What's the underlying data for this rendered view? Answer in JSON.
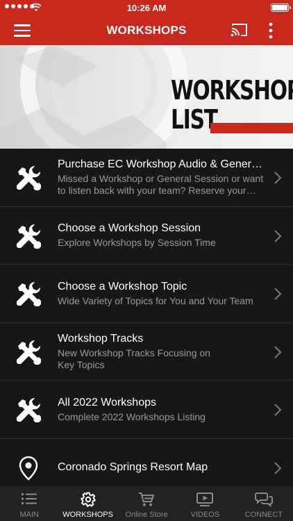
{
  "status_bar": {
    "time": "10:26 AM"
  },
  "nav": {
    "title": "WORKSHOPS"
  },
  "hero": {
    "title_line1": "WORKSHOP",
    "title_line2": "LIST"
  },
  "list": [
    {
      "title": "Purchase EC Workshop Audio & General Session",
      "subtitle": "Missed a Workshop or General Session or want to listen back with your team? Reserve your copy today",
      "icon": "tools-icon"
    },
    {
      "title": "Choose a Workshop Session",
      "subtitle": "Explore Workshops by Session Time",
      "icon": "tools-icon"
    },
    {
      "title": "Choose a Workshop Topic",
      "subtitle": "Wide Variety of Topics for You and Your Team",
      "icon": "tools-icon"
    },
    {
      "title": "Workshop Tracks",
      "subtitle": "New Workshop Tracks Focusing on Key Topics",
      "icon": "tools-icon"
    },
    {
      "title": "All 2022 Workshops",
      "subtitle": "Complete 2022 Workshops Listing",
      "icon": "tools-icon"
    },
    {
      "title": "Coronado Springs Resort Map",
      "subtitle": "",
      "icon": "map-pin-icon"
    }
  ],
  "tabs": [
    {
      "label": "MAIN",
      "icon": "list-icon"
    },
    {
      "label": "WORKSHOPS",
      "icon": "gear-icon"
    },
    {
      "label": "Online Store",
      "icon": "cart-icon"
    },
    {
      "label": "VIDEOS",
      "icon": "video-icon"
    },
    {
      "label": "CONNECT",
      "icon": "chat-icon"
    }
  ],
  "colors": {
    "brand_red": "#c8281e",
    "list_bg": "#171717",
    "tab_bg": "#222222"
  }
}
